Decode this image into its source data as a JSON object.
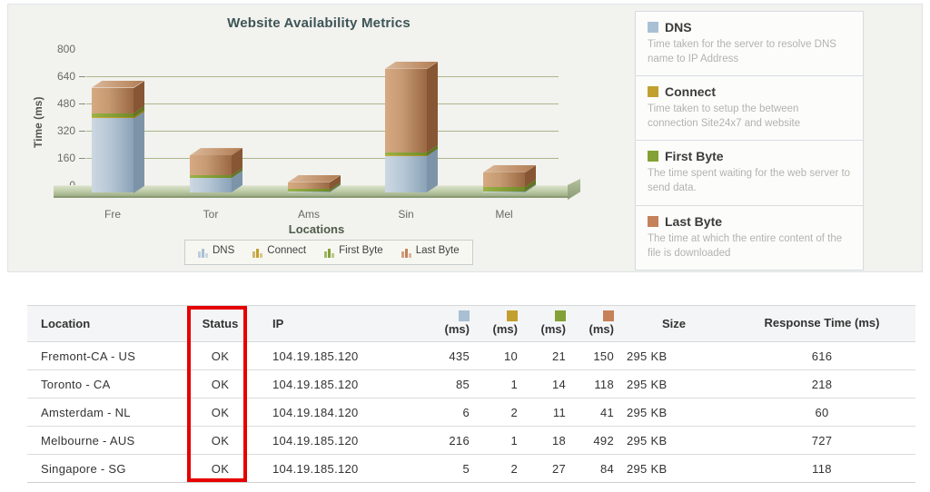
{
  "colors": {
    "dns": "#a9c0d4",
    "connect": "#c2a02f",
    "first_byte": "#83a136",
    "last_byte": "#c5815a",
    "annotation_red": "#e60000"
  },
  "chart_data": {
    "type": "bar",
    "variant": "stacked-3d",
    "title": "Website Availability Metrics",
    "xlabel": "Locations",
    "ylabel": "Time (ms)",
    "ylim": [
      0,
      800
    ],
    "yticks": [
      0,
      160,
      320,
      480,
      640,
      800
    ],
    "categories": [
      "Fre",
      "Tor",
      "Ams",
      "Sin",
      "Mel"
    ],
    "series": [
      {
        "name": "DNS",
        "color": "#a9c0d4",
        "values": [
          435,
          85,
          6,
          216,
          5
        ]
      },
      {
        "name": "Connect",
        "color": "#c2a02f",
        "values": [
          10,
          1,
          2,
          1,
          2
        ]
      },
      {
        "name": "First Byte",
        "color": "#83a136",
        "values": [
          21,
          14,
          11,
          18,
          27
        ]
      },
      {
        "name": "Last Byte",
        "color": "#c5815a",
        "values": [
          150,
          118,
          41,
          492,
          84
        ]
      }
    ],
    "legend_position": "bottom",
    "grid": true
  },
  "bottom_legend": [
    {
      "label": "DNS",
      "color": "#a9c0d4"
    },
    {
      "label": "Connect",
      "color": "#c2a02f"
    },
    {
      "label": "First Byte",
      "color": "#83a136"
    },
    {
      "label": "Last Byte",
      "color": "#c5815a"
    }
  ],
  "info_panel": [
    {
      "title": "DNS",
      "color": "#a9c0d4",
      "description": "Time taken for the server to resolve DNS name to IP Address"
    },
    {
      "title": "Connect",
      "color": "#c2a02f",
      "description": "Time taken to setup the between connection Site24x7 and website"
    },
    {
      "title": "First Byte",
      "color": "#83a136",
      "description": "The time spent waiting for the web server to send data."
    },
    {
      "title": "Last Byte",
      "color": "#c5815a",
      "description": "The time at which the entire content of the file is downloaded"
    }
  ],
  "table": {
    "columns": [
      {
        "key": "location",
        "label": "Location"
      },
      {
        "key": "status",
        "label": "Status"
      },
      {
        "key": "ip",
        "label": "IP"
      },
      {
        "key": "dns",
        "label": "(ms)",
        "color": "#a9c0d4"
      },
      {
        "key": "connect",
        "label": "(ms)",
        "color": "#c2a02f"
      },
      {
        "key": "first_byte",
        "label": "(ms)",
        "color": "#83a136"
      },
      {
        "key": "last_byte",
        "label": "(ms)",
        "color": "#c5815a"
      },
      {
        "key": "size",
        "label": "Size"
      },
      {
        "key": "response_time",
        "label": "Response Time (ms)"
      }
    ],
    "rows": [
      {
        "location": "Fremont-CA - US",
        "status": "OK",
        "ip": "104.19.185.120",
        "dns": "435",
        "connect": "10",
        "first_byte": "21",
        "last_byte": "150",
        "size": "295 KB",
        "response_time": "616"
      },
      {
        "location": "Toronto - CA",
        "status": "OK",
        "ip": "104.19.185.120",
        "dns": "85",
        "connect": "1",
        "first_byte": "14",
        "last_byte": "118",
        "size": "295 KB",
        "response_time": "218"
      },
      {
        "location": "Amsterdam - NL",
        "status": "OK",
        "ip": "104.19.184.120",
        "dns": "6",
        "connect": "2",
        "first_byte": "11",
        "last_byte": "41",
        "size": "295 KB",
        "response_time": "60"
      },
      {
        "location": "Melbourne - AUS",
        "status": "OK",
        "ip": "104.19.185.120",
        "dns": "216",
        "connect": "1",
        "first_byte": "18",
        "last_byte": "492",
        "size": "295 KB",
        "response_time": "727"
      },
      {
        "location": "Singapore - SG",
        "status": "OK",
        "ip": "104.19.185.120",
        "dns": "5",
        "connect": "2",
        "first_byte": "27",
        "last_byte": "84",
        "size": "295 KB",
        "response_time": "118"
      }
    ]
  }
}
